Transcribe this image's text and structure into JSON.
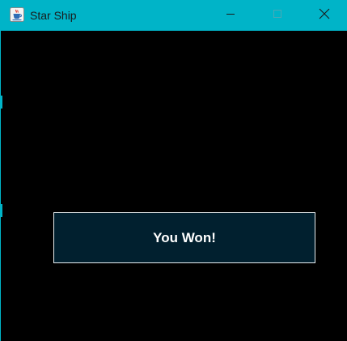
{
  "window": {
    "title": "Star Ship",
    "app_icon": "java-coffee-cup-icon",
    "controls": {
      "minimize_icon": "minimize-icon",
      "maximize_icon": "maximize-icon",
      "close_icon": "close-icon"
    }
  },
  "game": {
    "message": "You Won!"
  },
  "colors": {
    "titlebar": "#00b4c8",
    "background": "#000000",
    "message_box_fill": "#01202f",
    "message_box_border": "#e8eef0",
    "message_text": "#ffffff"
  }
}
